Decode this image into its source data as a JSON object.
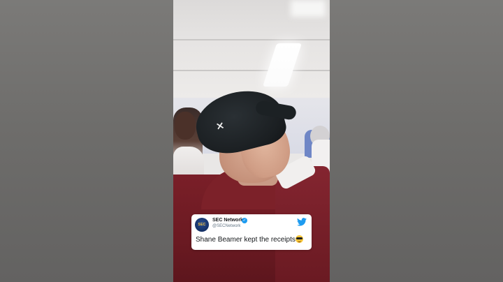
{
  "tweet": {
    "display_name": "SEC Network",
    "handle": "@SECNetwork",
    "text": "Shane Beamer kept the receipts",
    "emoji": "smiling-face-with-sunglasses",
    "verified": true,
    "avatar_text": "SEC"
  },
  "icons": {
    "verified": "verified-badge-icon",
    "platform": "twitter-bird-icon",
    "cap_logo": "under-armour-logo"
  },
  "colors": {
    "twitter_blue": "#1d9bf0",
    "shirt_garnet": "#7a1f28",
    "side_panel": "#6f6f6d"
  }
}
